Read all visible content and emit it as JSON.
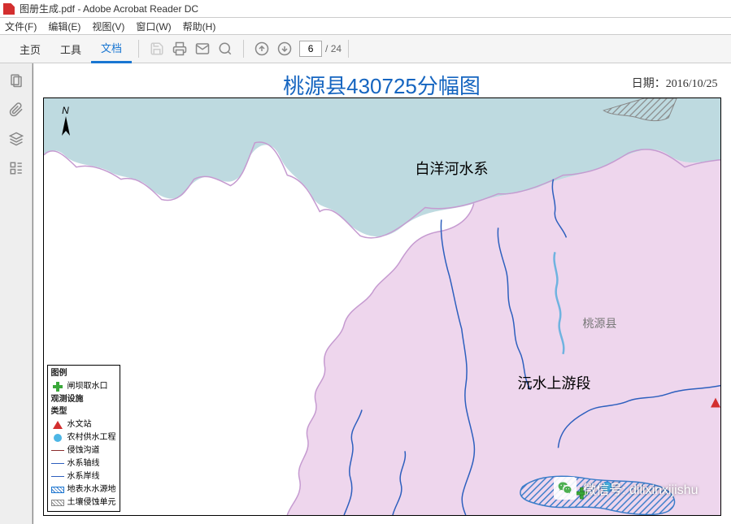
{
  "window": {
    "title": "图册生成.pdf - Adobe Acrobat Reader DC"
  },
  "menubar": {
    "file": "文件(F)",
    "edit": "编辑(E)",
    "view": "视图(V)",
    "window": "窗口(W)",
    "help": "帮助(H)"
  },
  "tabs": {
    "home": "主页",
    "tools": "工具",
    "document": "文档"
  },
  "pageNav": {
    "current": "6",
    "totalLabel": "/ 24"
  },
  "map": {
    "title": "桃源县430725分幅图",
    "dateLabel": "日期：",
    "date": "2016/10/25",
    "northLabel": "N",
    "labels": {
      "river": "白洋河水系",
      "county": "桃源县",
      "section": "沅水上游段"
    }
  },
  "legend": {
    "header": "图例",
    "intakes": "闸坝取水口",
    "facilities": "观测设施",
    "type": "类型",
    "hydro": "水文站",
    "rural": "农村供水工程",
    "erosion": "侵蚀沟道",
    "axis": "水系轴线",
    "boundary": "水系岸线",
    "source": "地表水水源地",
    "soil": "土壤侵蚀单元"
  },
  "watermark": {
    "text": "微信号: dilixinxijishu"
  }
}
